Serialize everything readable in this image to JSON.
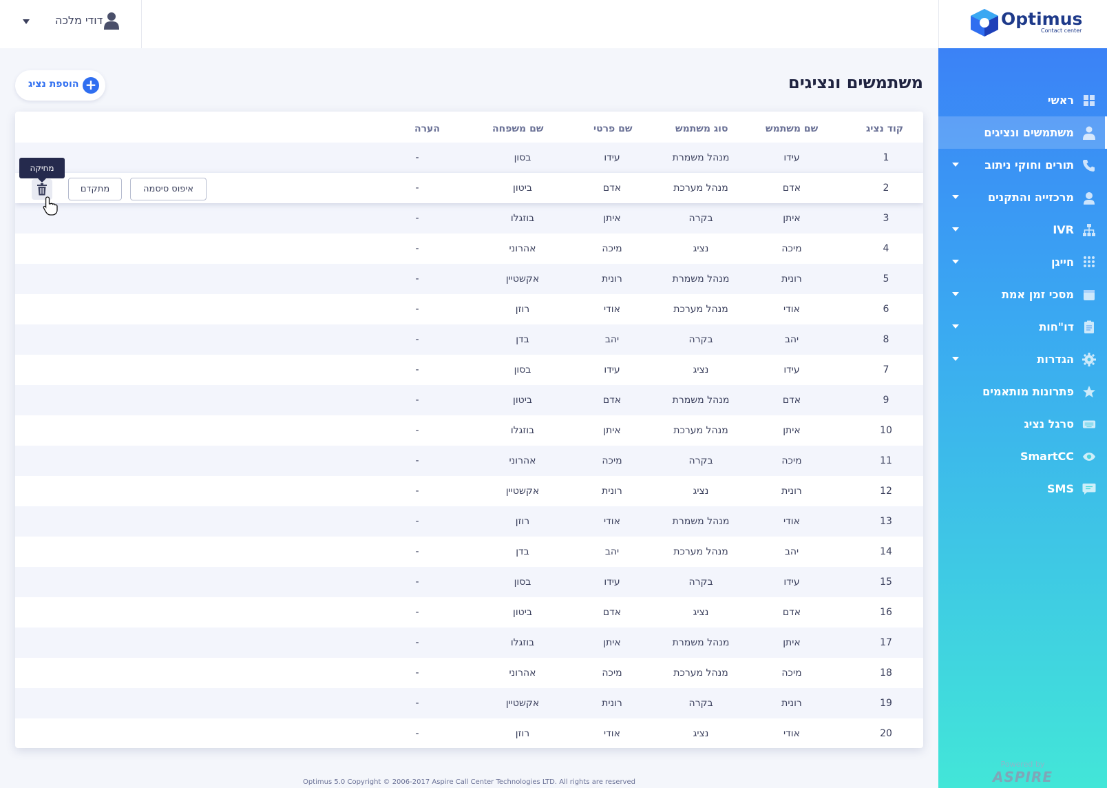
{
  "brand": {
    "name": "Optimus",
    "subtitle": "Contact center"
  },
  "user": {
    "name": "דודי מלכה"
  },
  "page": {
    "title": "משתמשים ונציגים",
    "add_button": "הוספת נציג"
  },
  "sidebar": {
    "items": [
      {
        "label": "ראשי",
        "icon": "grid-icon",
        "caret": false,
        "active": false
      },
      {
        "label": "משתמשים ונציגים",
        "icon": "user-icon",
        "caret": false,
        "active": true
      },
      {
        "label": "תורים וחוקי ניתוב",
        "icon": "phone-icon",
        "caret": true,
        "active": false
      },
      {
        "label": "מרכזייה והתקנים",
        "icon": "headset-icon",
        "caret": true,
        "active": false
      },
      {
        "label": "IVR",
        "icon": "sitemap-icon",
        "caret": true,
        "active": false
      },
      {
        "label": "חייגן",
        "icon": "dialpad-icon",
        "caret": true,
        "active": false
      },
      {
        "label": "מסכי זמן אמת",
        "icon": "monitor-icon",
        "caret": true,
        "active": false
      },
      {
        "label": "דו\"חות",
        "icon": "report-icon",
        "caret": true,
        "active": false
      },
      {
        "label": "הגדרות",
        "icon": "gear-icon",
        "caret": true,
        "active": false
      },
      {
        "label": "פתרונות מותאמים",
        "icon": "star-icon",
        "caret": false,
        "active": false
      },
      {
        "label": "סרגל נציג",
        "icon": "keyboard-icon",
        "caret": false,
        "active": false
      },
      {
        "label": "SmartCC",
        "icon": "eye-icon",
        "caret": false,
        "active": false
      },
      {
        "label": "SMS",
        "icon": "chat-icon",
        "caret": false,
        "active": false
      }
    ],
    "powered_by": "Powered by",
    "powered_brand": "ASPIRE"
  },
  "table": {
    "headers": {
      "code": "קוד נציג",
      "username": "שם משתמש",
      "type": "סוג משתמש",
      "first": "שם פרטי",
      "last": "שם משפחה",
      "note": "הערה"
    },
    "rows": [
      {
        "code": "1",
        "username": "עידו",
        "type": "מנהל משמרת",
        "first": "עידו",
        "last": "בסון",
        "note": "-"
      },
      {
        "code": "2",
        "username": "אדם",
        "type": "מנהל מערכת",
        "first": "אדם",
        "last": "ביטון",
        "note": "-"
      },
      {
        "code": "3",
        "username": "איתן",
        "type": "בקרה",
        "first": "איתן",
        "last": "בוזגלו",
        "note": "-"
      },
      {
        "code": "4",
        "username": "מיכה",
        "type": "נציג",
        "first": "מיכה",
        "last": "אהרוני",
        "note": "-"
      },
      {
        "code": "5",
        "username": "רונית",
        "type": "מנהל משמרת",
        "first": "רונית",
        "last": "אקשטיין",
        "note": "-"
      },
      {
        "code": "6",
        "username": "אודי",
        "type": "מנהל מערכת",
        "first": "אודי",
        "last": "רוזן",
        "note": "-"
      },
      {
        "code": "8",
        "username": "יהב",
        "type": "בקרה",
        "first": "יהב",
        "last": "בדן",
        "note": "-"
      },
      {
        "code": "7",
        "username": "עידו",
        "type": "נציג",
        "first": "עידו",
        "last": "בסון",
        "note": "-"
      },
      {
        "code": "9",
        "username": "אדם",
        "type": "מנהל משמרת",
        "first": "אדם",
        "last": "ביטון",
        "note": "-"
      },
      {
        "code": "10",
        "username": "איתן",
        "type": "מנהל מערכת",
        "first": "איתן",
        "last": "בוזגלו",
        "note": "-"
      },
      {
        "code": "11",
        "username": "מיכה",
        "type": "בקרה",
        "first": "מיכה",
        "last": "אהרוני",
        "note": "-"
      },
      {
        "code": "12",
        "username": "רונית",
        "type": "נציג",
        "first": "רונית",
        "last": "אקשטיין",
        "note": "-"
      },
      {
        "code": "13",
        "username": "אודי",
        "type": "מנהל משמרת",
        "first": "אודי",
        "last": "רוזן",
        "note": "-"
      },
      {
        "code": "14",
        "username": "יהב",
        "type": "מנהל מערכת",
        "first": "יהב",
        "last": "בדן",
        "note": "-"
      },
      {
        "code": "15",
        "username": "עידו",
        "type": "בקרה",
        "first": "עידו",
        "last": "בסון",
        "note": "-"
      },
      {
        "code": "16",
        "username": "אדם",
        "type": "נציג",
        "first": "אדם",
        "last": "ביטון",
        "note": "-"
      },
      {
        "code": "17",
        "username": "איתן",
        "type": "מנהל משמרת",
        "first": "איתן",
        "last": "בוזגלו",
        "note": "-"
      },
      {
        "code": "18",
        "username": "מיכה",
        "type": "מנהל מערכת",
        "first": "מיכה",
        "last": "אהרוני",
        "note": "-"
      },
      {
        "code": "19",
        "username": "רונית",
        "type": "בקרה",
        "first": "רונית",
        "last": "אקשטיין",
        "note": "-"
      },
      {
        "code": "20",
        "username": "אודי",
        "type": "נציג",
        "first": "אודי",
        "last": "רוזן",
        "note": "-"
      }
    ],
    "row_actions": {
      "reset_password": "איפוס סיסמה",
      "advanced": "מתקדם",
      "delete_tooltip": "מחיקה"
    }
  },
  "footer": {
    "copyright": "Optimus 5.0 Copyright © 2006-2017 Aspire Call Center Technologies LTD. All rights are reserved"
  },
  "colors": {
    "accent": "#2f6ef0",
    "sidebar_top": "#3b7bf7",
    "sidebar_bottom": "#42e6d8",
    "tooltip": "#252a4d"
  }
}
